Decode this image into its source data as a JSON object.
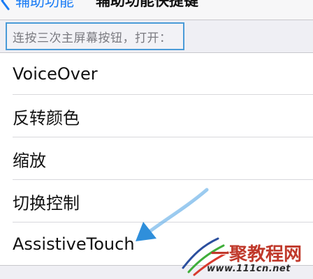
{
  "navbar": {
    "back_label": "辅助功能",
    "title": "辅助功能快捷键"
  },
  "section": {
    "header": "连按三次主屏幕按钮，打开："
  },
  "options": [
    {
      "label": "VoiceOver"
    },
    {
      "label": "反转颜色"
    },
    {
      "label": "缩放"
    },
    {
      "label": "切换控制"
    },
    {
      "label": "AssistiveTouch"
    }
  ],
  "watermark": {
    "text": "一聚教程网",
    "url": "www.111cn.net"
  },
  "colors": {
    "accent": "#1a7cf5",
    "annotation": "#3b9be0",
    "watermark": "#c0392b"
  },
  "icons": [
    "chevron-left-icon",
    "arrow-annotation"
  ]
}
